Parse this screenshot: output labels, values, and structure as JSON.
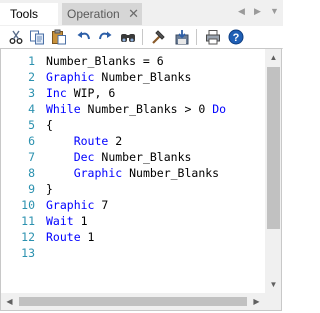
{
  "tabs": [
    {
      "label": "Tools",
      "active": true
    },
    {
      "label": "Operation",
      "active": false
    }
  ],
  "tab_close_glyph": "✕",
  "tab_nav": {
    "prev": "◀",
    "next": "▶",
    "menu": "▼"
  },
  "toolbar": {
    "buttons": [
      "cut-icon",
      "copy-icon",
      "paste-icon",
      "undo-icon",
      "redo-icon",
      "find-icon",
      "build-icon",
      "save-icon",
      "print-icon",
      "help-icon"
    ]
  },
  "editor": {
    "lines": [
      {
        "num": "1",
        "kw": "",
        "text": "Number_Blanks = 6"
      },
      {
        "num": "2",
        "kw": "Graphic",
        "text": " Number_Blanks"
      },
      {
        "num": "3",
        "kw": "Inc",
        "text": " WIP, 6"
      },
      {
        "num": "4",
        "kw": "While",
        "text": " Number_Blanks > 0 ",
        "kw2": "Do"
      },
      {
        "num": "5",
        "kw": "",
        "text": "{"
      },
      {
        "num": "6",
        "indent": "    ",
        "kw": "Route",
        "text": " 2"
      },
      {
        "num": "7",
        "indent": "    ",
        "kw": "Dec",
        "text": " Number_Blanks"
      },
      {
        "num": "8",
        "indent": "    ",
        "kw": "Graphic",
        "text": " Number_Blanks"
      },
      {
        "num": "9",
        "kw": "",
        "text": "}"
      },
      {
        "num": "10",
        "kw": "Graphic",
        "text": " 7"
      },
      {
        "num": "11",
        "kw": "Wait",
        "text": " 1"
      },
      {
        "num": "12",
        "kw": "Route",
        "text": " 1"
      },
      {
        "num": "13",
        "kw": "",
        "text": ""
      }
    ]
  },
  "colors": {
    "keyword": "#0000ff",
    "line_number": "#2b91af",
    "text": "#000000"
  },
  "scroll": {
    "up": "▲",
    "down": "▼",
    "left": "◀",
    "right": "▶"
  }
}
